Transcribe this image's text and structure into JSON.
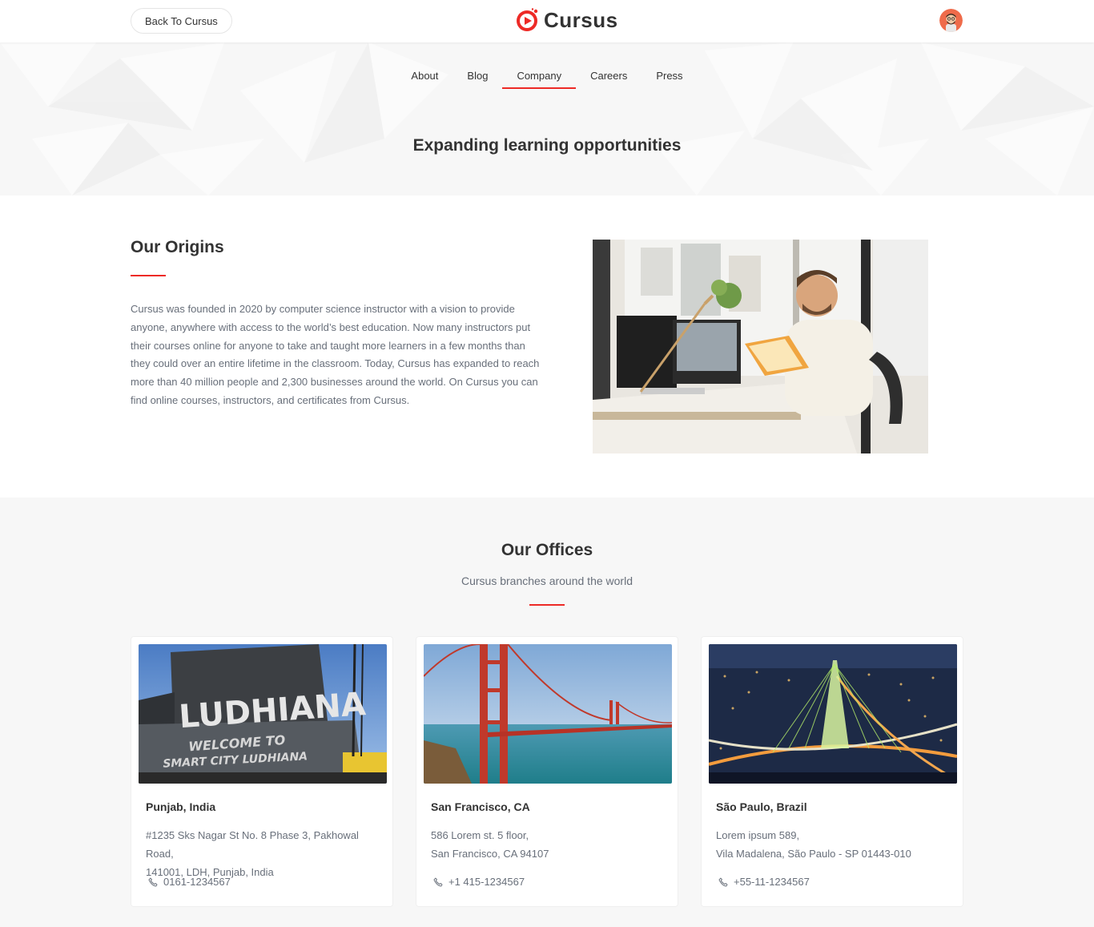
{
  "header": {
    "back_label": "Back To Cursus",
    "logo_text": "Cursus"
  },
  "tabs": [
    {
      "label": "About",
      "active": false
    },
    {
      "label": "Blog",
      "active": false
    },
    {
      "label": "Company",
      "active": true
    },
    {
      "label": "Careers",
      "active": false
    },
    {
      "label": "Press",
      "active": false
    }
  ],
  "hero": {
    "title": "Expanding learning opportunities"
  },
  "origins": {
    "title": "Our Origins",
    "body": "Cursus was founded in 2020 by computer science instructor with a vision to provide anyone, anywhere with access to the world’s best education. Now many instructors put their courses online for anyone to take and taught more learners in a few months than they could over an entire lifetime in the classroom. Today, Cursus has expanded to reach more than 40 million people and 2,300 businesses around the world. On Cursus you can find online courses, instructors, and certificates from Cursus."
  },
  "offices": {
    "title": "Our Offices",
    "subtitle": "Cursus branches around the world",
    "cards": [
      {
        "city": "Punjab, India",
        "address_line1": "#1235 Sks Nagar St No. 8 Phase 3, Pakhowal Road,",
        "address_line2": "141001, LDH, Punjab, India",
        "phone": "0161-1234567",
        "sign_line1": "LUDHIANA",
        "sign_line2": "WELCOME TO",
        "sign_line3": "SMART CITY LUDHIANA"
      },
      {
        "city": "San Francisco, CA",
        "address_line1": "586 Lorem st. 5 floor,",
        "address_line2": "San Francisco, CA 94107",
        "phone": "+1 415-1234567"
      },
      {
        "city": "São Paulo, Brazil",
        "address_line1": "Lorem ipsum 589,",
        "address_line2": "Vila Madalena, São Paulo - SP 01443-010",
        "phone": "+55-11-1234567"
      }
    ]
  },
  "colors": {
    "accent": "#ed2a26",
    "text": "#333333",
    "muted": "#686f7a",
    "section_bg": "#f7f7f7"
  },
  "icons": [
    "cursus-logo-icon",
    "avatar",
    "phone-icon"
  ]
}
